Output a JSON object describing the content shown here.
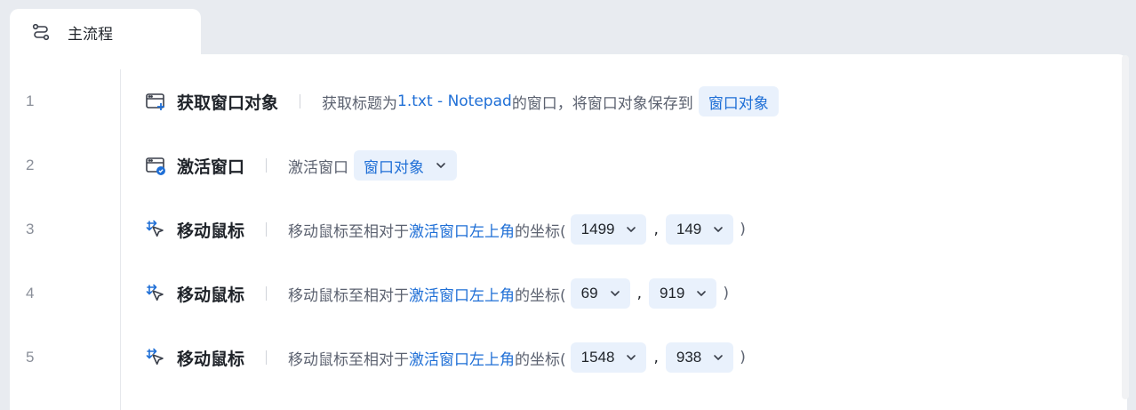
{
  "tab": {
    "label": "主流程"
  },
  "rows": [
    {
      "line": "1",
      "title": "获取窗口对象",
      "desc_prefix": "获取标题为",
      "desc_link": "1.txt - Notepad",
      "desc_suffix": "的窗口，将窗口对象保存到",
      "var": "窗口对象"
    },
    {
      "line": "2",
      "title": "激活窗口",
      "desc_prefix": "激活窗口",
      "var": "窗口对象"
    },
    {
      "line": "3",
      "title": "移动鼠标",
      "desc_prefix": "移动鼠标至相对于",
      "desc_link": "激活窗口左上角",
      "desc_suffix": "的坐标(",
      "x": "1499",
      "comma": ",",
      "y": "149",
      "close": ")"
    },
    {
      "line": "4",
      "title": "移动鼠标",
      "desc_prefix": "移动鼠标至相对于",
      "desc_link": "激活窗口左上角",
      "desc_suffix": "的坐标(",
      "x": "69",
      "comma": ",",
      "y": "919",
      "close": ")"
    },
    {
      "line": "5",
      "title": "移动鼠标",
      "desc_prefix": "移动鼠标至相对于",
      "desc_link": "激活窗口左上角",
      "desc_suffix": "的坐标(",
      "x": "1548",
      "comma": ",",
      "y": "938",
      "close": ")"
    }
  ],
  "icons": {
    "tab": "flow-icon",
    "row1": "window-add-icon",
    "row2": "window-check-icon",
    "mouse": "mouse-move-icon",
    "dropdown": "chevron-down-icon"
  },
  "colors": {
    "link": "#1f6fd6",
    "chip_bg": "#e9f1fc",
    "background": "#e8ebf0"
  }
}
